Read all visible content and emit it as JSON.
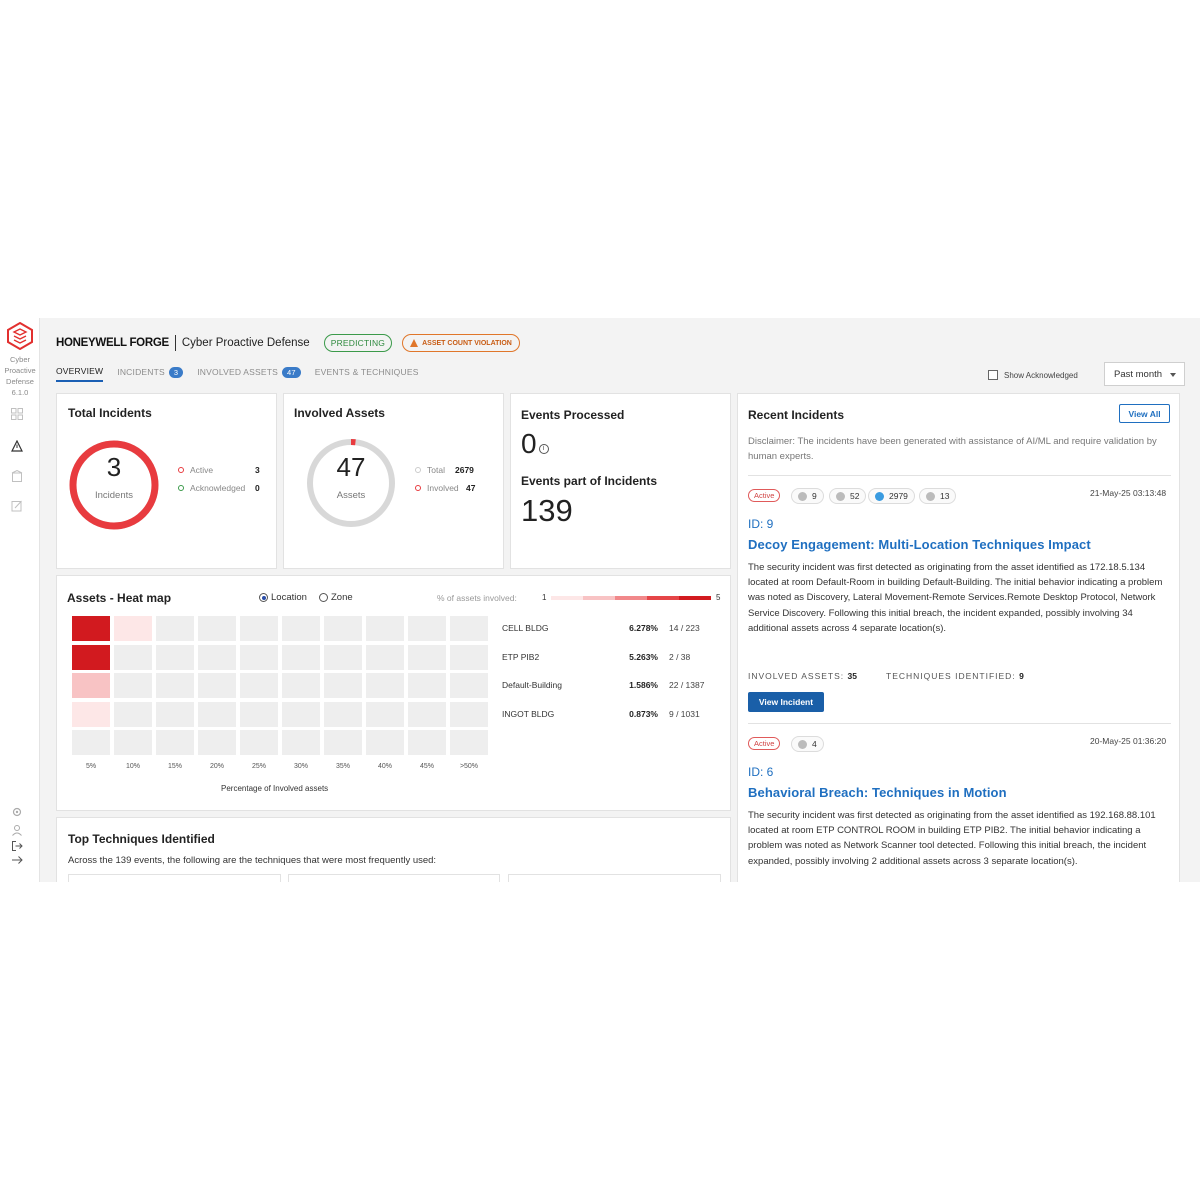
{
  "sidebar": {
    "app_name_lines": [
      "Cyber",
      "Proactive",
      "Defense"
    ],
    "version": "6.1.0",
    "icons": [
      "dashboard-icon",
      "alert-icon",
      "building-icon",
      "report-icon",
      "settings-icon",
      "user-icon",
      "logout-icon",
      "expand-icon"
    ]
  },
  "header": {
    "brand": "HONEYWELL FORGE",
    "product": "Cyber Proactive Defense",
    "status_pill": "PREDICTING",
    "violation_pill": "ASSET COUNT VIOLATION"
  },
  "tabs": [
    {
      "label": "OVERVIEW",
      "badge": ""
    },
    {
      "label": "INCIDENTS",
      "badge": "3"
    },
    {
      "label": "INVOLVED ASSETS",
      "badge": "47"
    },
    {
      "label": "EVENTS & TECHNIQUES",
      "badge": ""
    }
  ],
  "filters": {
    "show_acknowledged": "Show Acknowledged",
    "range": "Past month"
  },
  "total_incidents": {
    "title": "Total Incidents",
    "count": "3",
    "label": "Incidents",
    "active_label": "Active",
    "active_value": "3",
    "ack_label": "Acknowledged",
    "ack_value": "0",
    "active_fraction": 1.0
  },
  "involved_assets": {
    "title": "Involved Assets",
    "count": "47",
    "label": "Assets",
    "total_label": "Total",
    "total_value": "2679",
    "involved_label": "Involved",
    "involved_value": "47",
    "involved_fraction": 0.0175
  },
  "events": {
    "processed_title": "Events Processed",
    "processed_value": "0",
    "part_title": "Events part of Incidents",
    "part_value": "139"
  },
  "heatmap": {
    "title": "Assets - Heat map",
    "opt_location": "Location",
    "opt_zone": "Zone",
    "scale_label": "% of assets involved:",
    "scale_min": "1",
    "scale_max": "5",
    "x_labels": [
      "5%",
      "10%",
      "15%",
      "20%",
      "25%",
      "30%",
      "35%",
      "40%",
      "45%",
      ">50%"
    ],
    "x_title": "Percentage of Involved assets",
    "rows": [
      {
        "location": "CELL BLDG",
        "pct": "6.278%",
        "ratio": "14 / 223"
      },
      {
        "location": "ETP PIB2",
        "pct": "5.263%",
        "ratio": "2 / 38"
      },
      {
        "location": "Default-Building",
        "pct": "1.586%",
        "ratio": "22 / 1387"
      },
      {
        "location": "INGOT BLDG",
        "pct": "0.873%",
        "ratio": "9 / 1031"
      }
    ],
    "colors": {
      "c5": "#d21a1f",
      "c4": "#e54548",
      "c3": "#f1888a",
      "c2": "#f8c3c4",
      "c1": "#fde7e7",
      "empty": "#eeeeee"
    }
  },
  "techniques": {
    "title": "Top Techniques Identified",
    "subtitle": "Across the 139 events, the following are the techniques that were most frequently used:"
  },
  "recent": {
    "title": "Recent Incidents",
    "view_all": "View All",
    "disclaimer": "Disclaimer: The incidents have been generated with assistance of AI/ML and require validation by human experts.",
    "incidents": [
      {
        "status": "Active",
        "chips": [
          "9",
          "52",
          "2979",
          "13"
        ],
        "date": "21-May-25 03:13:48",
        "id": "ID: 9",
        "title": "Decoy Engagement: Multi-Location Techniques Impact",
        "desc": "The security incident was first detected as originating from the asset identified as 172.18.5.134 located at room Default-Room in building Default-Building. The initial behavior indicating a problem was noted as Discovery, Lateral Movement-Remote Services.Remote Desktop Protocol, Network Service Discovery. Following this initial breach, the incident expanded, possibly involving 34 additional assets across 4 separate location(s).",
        "assets_label": "INVOLVED ASSETS:",
        "assets_value": "35",
        "tech_label": "TECHNIQUES IDENTIFIED:",
        "tech_value": "9",
        "button": "View Incident"
      },
      {
        "status": "Active",
        "chips": [
          "4"
        ],
        "date": "20-May-25 01:36:20",
        "id": "ID: 6",
        "title": "Behavioral Breach: Techniques in Motion",
        "desc": "The security incident was first detected as originating from the asset identified as 192.168.88.101 located at room ETP CONTROL ROOM in building ETP PIB2. The initial behavior indicating a problem was noted as Network Scanner tool detected. Following this initial breach, the incident expanded, possibly involving 2 additional assets across 3 separate location(s)."
      }
    ]
  },
  "colors": {
    "accent_blue": "#1f6fc0",
    "incident_red": "#e83b3f",
    "predict_green": "#3b9a4a",
    "violation_orange": "#e0762a"
  }
}
